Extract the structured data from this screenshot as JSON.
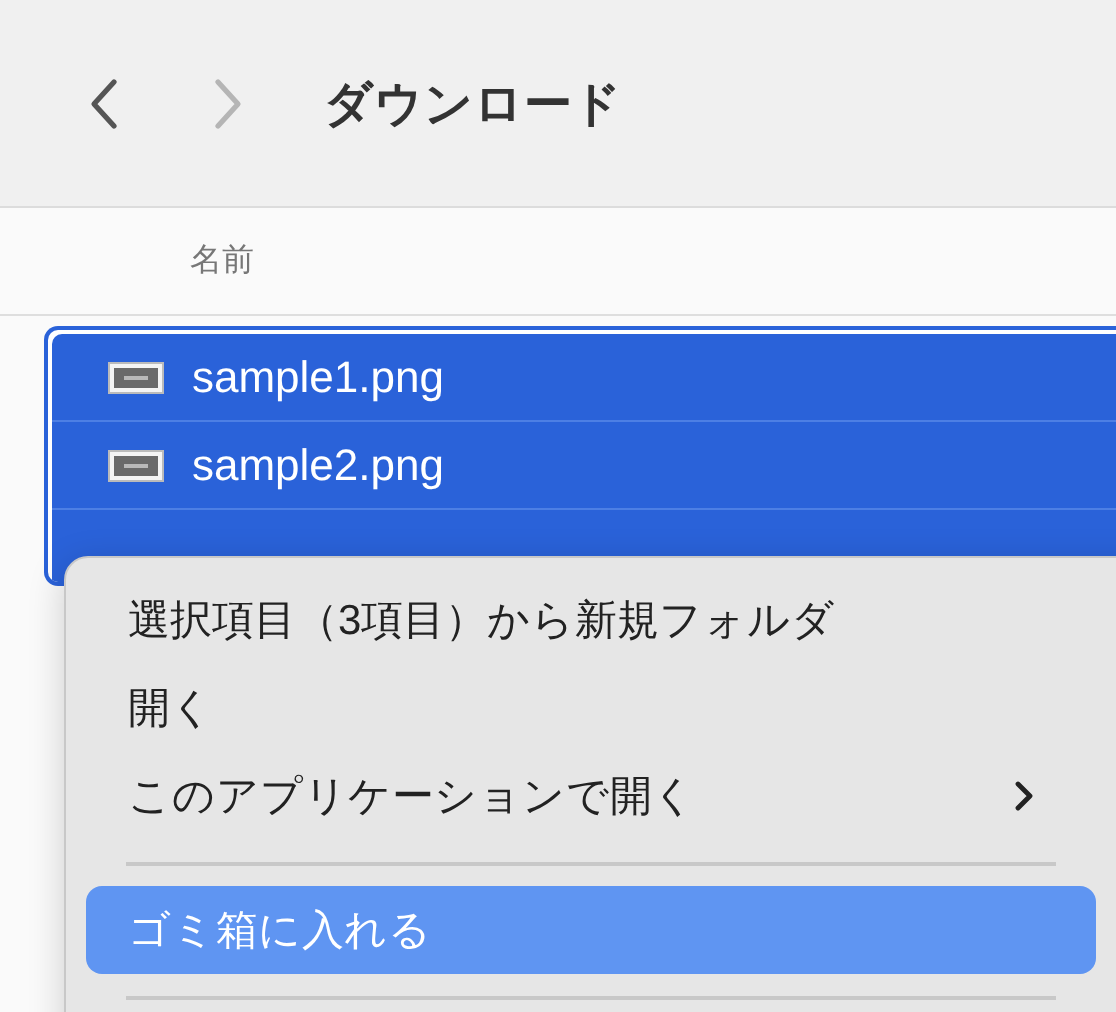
{
  "toolbar": {
    "title": "ダウンロード",
    "back_disabled": false,
    "forward_disabled": true
  },
  "column_header": "名前",
  "files": [
    {
      "name": "sample1.png",
      "selected": true
    },
    {
      "name": "sample2.png",
      "selected": true
    },
    {
      "selected": true
    }
  ],
  "context_menu": [
    {
      "kind": "item",
      "label": "選択項目（3項目）から新規フォルダ",
      "selected": false
    },
    {
      "kind": "item",
      "label": "開く",
      "selected": false
    },
    {
      "kind": "submenu",
      "label": "このアプリケーションで開く",
      "selected": false
    },
    {
      "kind": "separator"
    },
    {
      "kind": "item",
      "label": "ゴミ箱に入れる",
      "selected": true
    },
    {
      "kind": "separator"
    }
  ]
}
